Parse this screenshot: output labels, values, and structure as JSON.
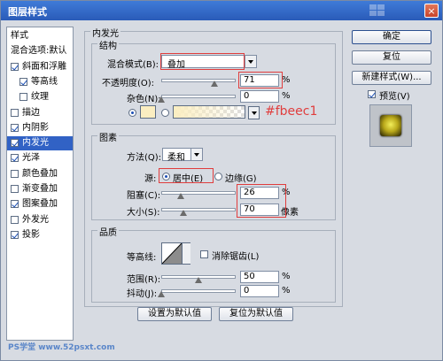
{
  "window": {
    "title": "图层样式",
    "close_label": "×"
  },
  "sidebar": {
    "items": [
      {
        "label": "样式",
        "check": null
      },
      {
        "label": "混合选项:默认",
        "check": null
      },
      {
        "label": "斜面和浮雕",
        "check": true
      },
      {
        "label": "等高线",
        "check": true,
        "indent": true
      },
      {
        "label": "纹理",
        "check": false,
        "indent": true
      },
      {
        "label": "描边",
        "check": false
      },
      {
        "label": "内阴影",
        "check": true
      },
      {
        "label": "内发光",
        "check": true,
        "selected": true
      },
      {
        "label": "光泽",
        "check": true
      },
      {
        "label": "颜色叠加",
        "check": false
      },
      {
        "label": "渐变叠加",
        "check": false
      },
      {
        "label": "图案叠加",
        "check": true
      },
      {
        "label": "外发光",
        "check": false
      },
      {
        "label": "投影",
        "check": true
      }
    ]
  },
  "panel": {
    "title": "内发光",
    "structure": {
      "title": "结构",
      "blend_mode_label": "混合模式(B):",
      "blend_mode_value": "叠加",
      "opacity_label": "不透明度(O):",
      "opacity_value": "71",
      "opacity_level": 0.71,
      "noise_label": "杂色(N):",
      "noise_value": "0",
      "noise_level": 0,
      "color_hex": "#fbeec1",
      "color_annotation": "#fbeec1",
      "unit": "%"
    },
    "elements": {
      "title": "图素",
      "method_label": "方法(Q):",
      "method_value": "柔和",
      "source_label": "源:",
      "source_center": "居中(E)",
      "source_edge": "边缘(G)",
      "choke_label": "阻塞(C):",
      "choke_value": "26",
      "choke_level": 0.26,
      "size_label": "大小(S):",
      "size_value": "70",
      "size_unit": "像素",
      "unit": "%"
    },
    "quality": {
      "title": "品质",
      "contour_label": "等高线:",
      "antialias_label": "消除锯齿(L)",
      "range_label": "范围(R):",
      "range_value": "50",
      "range_level": 0.5,
      "jitter_label": "抖动(J):",
      "jitter_value": "0",
      "jitter_level": 0,
      "unit": "%"
    },
    "buttons": {
      "set_default": "设置为默认值",
      "reset_default": "复位为默认值"
    }
  },
  "right": {
    "ok": "确定",
    "reset": "复位",
    "new_style": "新建样式(W)...",
    "preview_label": "预览(V)"
  },
  "watermark": {
    "text": "PS学堂 www.52psxt.com"
  }
}
